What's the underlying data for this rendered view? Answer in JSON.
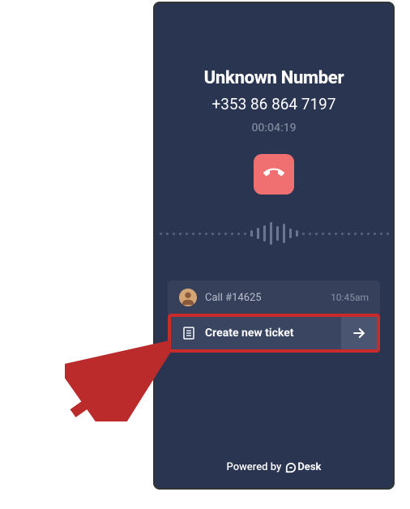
{
  "caller": {
    "name": "Unknown Number",
    "phone": "+353 86 864 7197",
    "duration": "00:04:19"
  },
  "ticket": {
    "label": "Call #14625",
    "time": "10:45am"
  },
  "create": {
    "label": "Create new ticket"
  },
  "footer": {
    "powered_by": "Powered by",
    "brand": "Desk"
  }
}
